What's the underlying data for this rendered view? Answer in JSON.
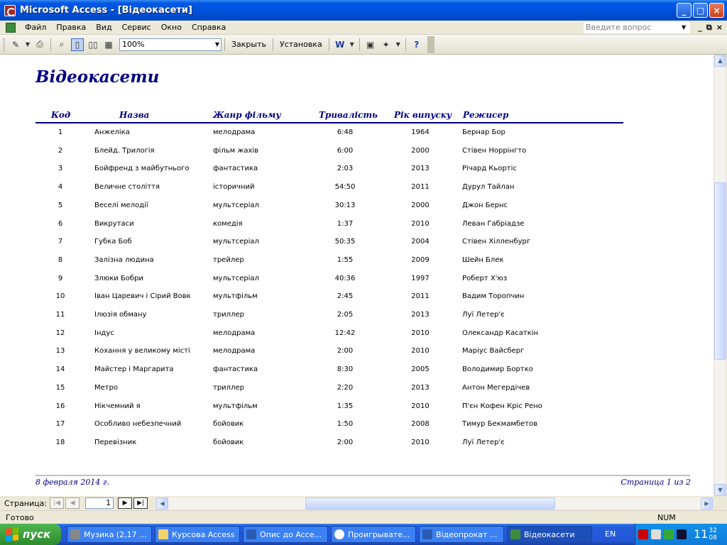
{
  "window": {
    "title": "Microsoft Access - [Відеокасети]",
    "controls": {
      "minimize": "_",
      "maximize": "□",
      "close": "×"
    }
  },
  "menu": {
    "items": [
      "Файл",
      "Правка",
      "Вид",
      "Сервис",
      "Окно",
      "Справка"
    ],
    "ask_placeholder": "Введите вопрос",
    "mdi_controls": {
      "minimize": "_",
      "restore": "⧉",
      "close": "×"
    }
  },
  "toolbar": {
    "zoom": "100%",
    "close_label": "Закрыть",
    "setup_label": "Установка"
  },
  "report": {
    "title": "Відеокасети",
    "columns": [
      "Код",
      "Назва",
      "Жанр фільму",
      "Тривалість",
      "Рік випуску",
      "Режисер"
    ],
    "rows": [
      [
        "1",
        "Анжеліка",
        "мелодрама",
        "6:48",
        "1964",
        "Бернар Бор"
      ],
      [
        "2",
        "Блейд. Трилогія",
        "фільм жахів",
        "6:00",
        "2000",
        "Стівен Норрінгто"
      ],
      [
        "3",
        "Бойфренд з майбутнього",
        "фантастика",
        "2:03",
        "2013",
        "Річард Кьортіс"
      ],
      [
        "4",
        "Величне століття",
        "історичний",
        "54:50",
        "2011",
        "Дурул Тайлан"
      ],
      [
        "5",
        "Веселі мелодії",
        "мультсеріал",
        "30:13",
        "2000",
        "Джон Бернс"
      ],
      [
        "6",
        "Викрутаси",
        "комедія",
        "1:37",
        "2010",
        "Леван Габріадзе"
      ],
      [
        "7",
        "Губка Боб",
        "мультсеріал",
        "50:35",
        "2004",
        "Стівен Хілленбург"
      ],
      [
        "8",
        "Залізна людина",
        "трейлер",
        "1:55",
        "2009",
        "Шейн Блек"
      ],
      [
        "9",
        "Злюки Бобри",
        "мультсеріал",
        "40:36",
        "1997",
        "Роберт Х'юз"
      ],
      [
        "10",
        "Іван Царевич і Сірий Вовк",
        "мультфільм",
        "2:45",
        "2011",
        "Вадим Торопчин"
      ],
      [
        "11",
        "Ілюзія обману",
        "триллер",
        "2:05",
        "2013",
        "Луї Летер'є"
      ],
      [
        "12",
        "Індус",
        "мелодрама",
        "12:42",
        "2010",
        "Олександр Касаткін"
      ],
      [
        "13",
        "Кохання у великому місті",
        "мелодрама",
        "2:00",
        "2010",
        "Маріус Вайсберг"
      ],
      [
        "14",
        "Майстер і Маргарита",
        "фантастика",
        "8:30",
        "2005",
        "Володимир Бортко"
      ],
      [
        "15",
        "Метро",
        "триллер",
        "2:20",
        "2013",
        "Антон Мегердічев"
      ],
      [
        "16",
        "Нікчемний я",
        "мультфільм",
        "1:35",
        "2010",
        "П'єн Кофен Кріс Рено"
      ],
      [
        "17",
        "Особливо небезпечний",
        "бойовик",
        "1:50",
        "2008",
        "Тимур Бекмамбетов"
      ],
      [
        "18",
        "Перевізник",
        "бойовик",
        "2:00",
        "2010",
        "Луї Летер'є"
      ]
    ],
    "footer_date": "8 февраля 2014 г.",
    "footer_page": "Страница 1 из 2"
  },
  "navigation": {
    "label": "Страница:",
    "page_value": "1"
  },
  "status": {
    "text": "Готово",
    "num": "NUM"
  },
  "taskbar": {
    "start_label": "пуск",
    "tasks": [
      "Музика (2,17 ...",
      "Курсова Access",
      "Опис до Acce...",
      "Проигрывате...",
      "Відеопрокат ...",
      "Відеокасети"
    ],
    "lang": "EN",
    "clock": {
      "hours": "11",
      "minutes": "32",
      "seconds": "08"
    }
  }
}
